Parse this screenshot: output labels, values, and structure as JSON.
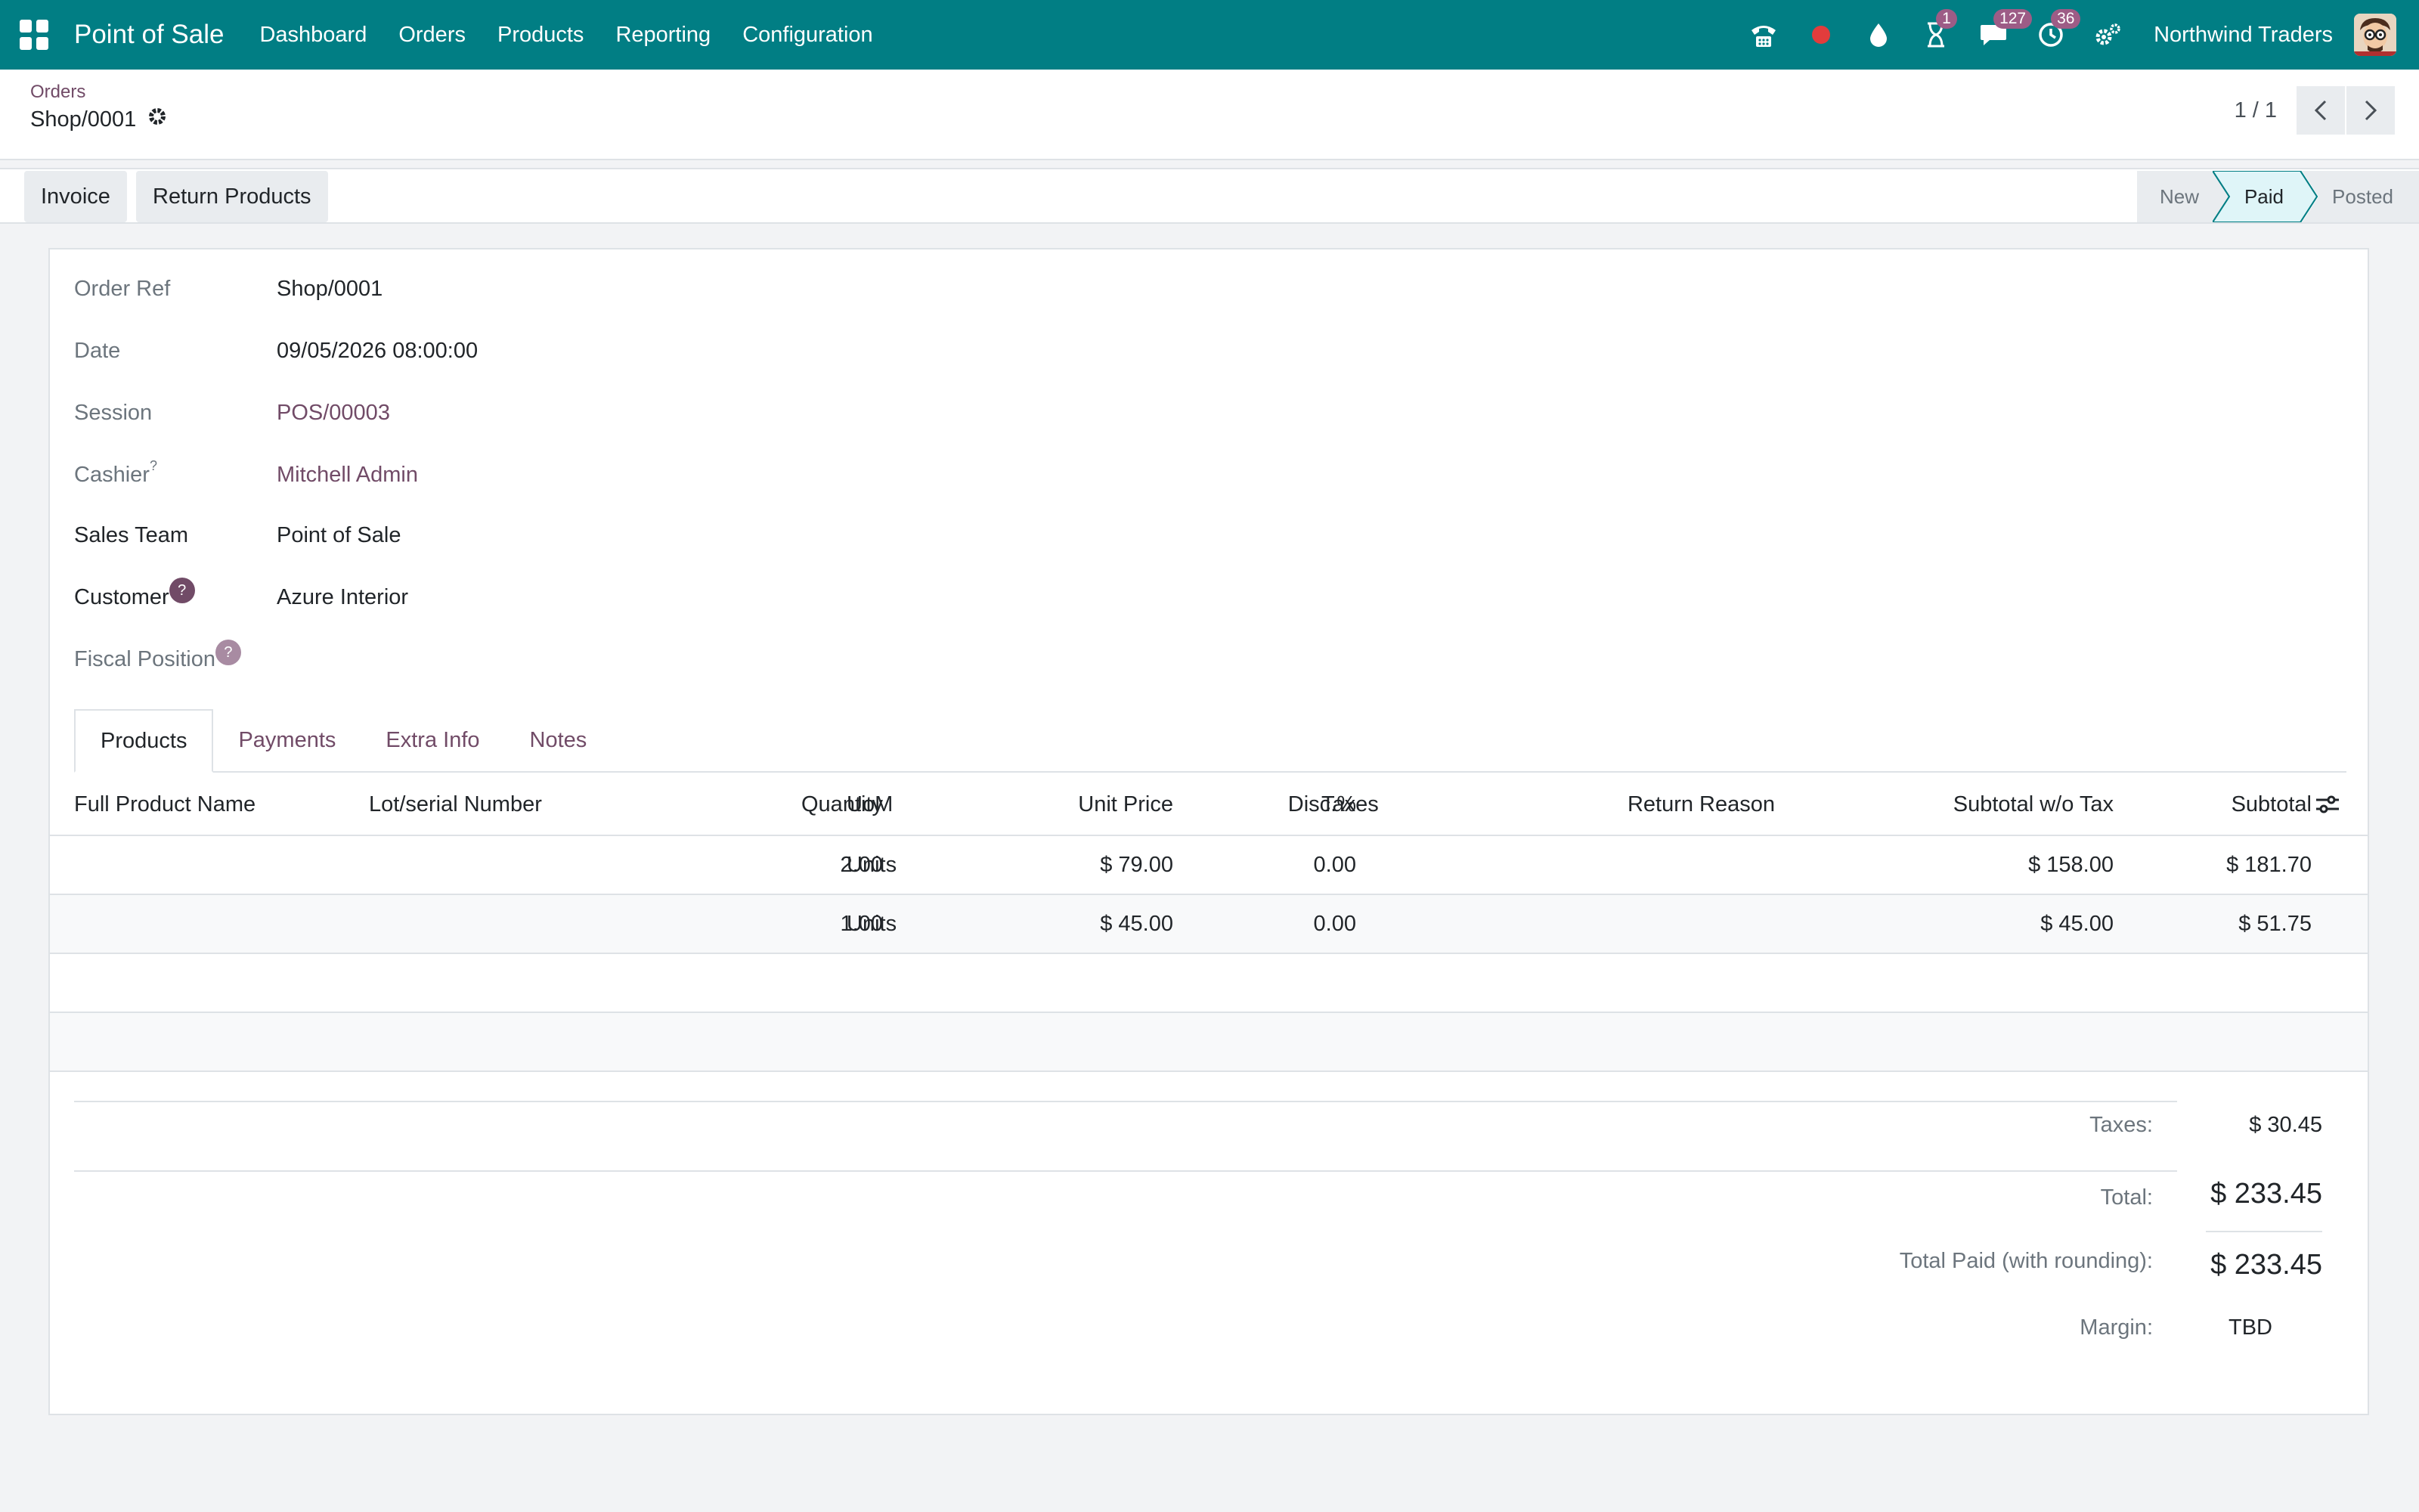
{
  "navbar": {
    "app_title": "Point of Sale",
    "menu": [
      "Dashboard",
      "Orders",
      "Products",
      "Reporting",
      "Configuration"
    ],
    "badges": {
      "activity": "1",
      "messages": "127",
      "clock": "36"
    },
    "company": "Northwind Traders",
    "icons": [
      "apps-grid-icon",
      "phone-icon",
      "record-dot-icon",
      "drop-icon",
      "hourglass-icon",
      "chat-icon",
      "clock-icon",
      "settings-icon"
    ]
  },
  "breadcrumb": {
    "parent": "Orders",
    "current": "Shop/0001"
  },
  "pager": {
    "value": "1 / 1"
  },
  "actions": {
    "invoice": "Invoice",
    "return_products": "Return Products"
  },
  "status": {
    "stages": [
      "New",
      "Paid",
      "Posted"
    ],
    "current": "Paid"
  },
  "form": {
    "order_ref": {
      "label": "Order Ref",
      "value": "Shop/0001"
    },
    "date": {
      "label": "Date",
      "value": "09/05/2026 08:00:00"
    },
    "session": {
      "label": "Session",
      "value": "POS/00003"
    },
    "cashier": {
      "label": "Cashier",
      "sup": "?",
      "value": "Mitchell Admin"
    },
    "sales_team": {
      "label": "Sales Team",
      "value": "Point of Sale"
    },
    "customer": {
      "label": "Customer",
      "help": "?",
      "value": "Azure Interior"
    },
    "fiscal_position": {
      "label": "Fiscal Position",
      "help": "?",
      "value": ""
    }
  },
  "tabs": [
    "Products",
    "Payments",
    "Extra Info",
    "Notes"
  ],
  "table": {
    "headers": {
      "product": "Full Product Name",
      "lot": "Lot/serial Number",
      "quantity": "Quantity",
      "uom": "UoM",
      "unit_price": "Unit Price",
      "discount": "Disc.%",
      "taxes": "Taxes",
      "return_reason": "Return Reason",
      "subtotal_wo_tax": "Subtotal w/o Tax",
      "subtotal": "Subtotal"
    },
    "rows": [
      {
        "quantity": "2.00",
        "uom": "Units",
        "unit_price": "$ 79.00",
        "discount": "0.00",
        "subtotal_wo_tax": "$ 158.00",
        "subtotal": "$ 181.70"
      },
      {
        "quantity": "1.00",
        "uom": "Units",
        "unit_price": "$ 45.00",
        "discount": "0.00",
        "subtotal_wo_tax": "$ 45.00",
        "subtotal": "$ 51.75"
      }
    ]
  },
  "totals": {
    "taxes_label": "Taxes:",
    "taxes": "$ 30.45",
    "total_label": "Total:",
    "total": "$ 233.45",
    "paid_label": "Total Paid (with rounding):",
    "paid": "$ 233.45",
    "margin_label": "Margin:",
    "margin": "TBD"
  },
  "colors": {
    "primary": "#017e84",
    "link": "#714b67",
    "badge": "#9d5c86",
    "stage_active": "#dff5f8"
  }
}
